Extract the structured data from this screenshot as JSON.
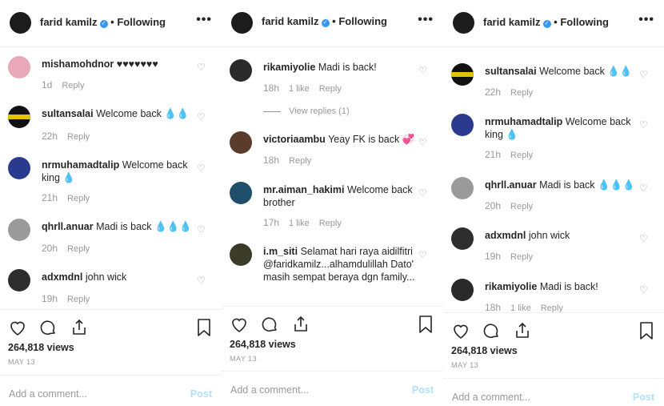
{
  "header": {
    "username": "farid kamilz",
    "separator": "•",
    "following": "Following",
    "more": "•••"
  },
  "panels": [
    {
      "comments": [
        {
          "user": "mishamohdnor",
          "text": "♥♥♥♥♥♥♥",
          "time": "1d",
          "likes": "",
          "reply": "Reply"
        },
        {
          "user": "sultansalai",
          "text": "Welcome back 💧💧",
          "time": "22h",
          "likes": "",
          "reply": "Reply"
        },
        {
          "user": "nrmuhamadtalip",
          "text": "Welcome back king 💧",
          "time": "21h",
          "likes": "",
          "reply": "Reply"
        },
        {
          "user": "qhrll.anuar",
          "text": "Madi is back 💧💧💧",
          "time": "20h",
          "likes": "",
          "reply": "Reply"
        },
        {
          "user": "adxmdnl",
          "text": "john wick",
          "time": "19h",
          "likes": "",
          "reply": "Reply"
        }
      ],
      "views": "264,818 views",
      "date": "MAY 13"
    },
    {
      "comments": [
        {
          "user": "rikamiyolie",
          "text": "Madi is back!",
          "time": "18h",
          "likes": "1 like",
          "reply": "Reply"
        },
        {
          "user": "victoriaambu",
          "text": "Yeay FK is back 💞",
          "time": "18h",
          "likes": "",
          "reply": "Reply"
        },
        {
          "user": "mr.aiman_hakimi",
          "text": "Welcome back brother",
          "time": "17h",
          "likes": "1 like",
          "reply": "Reply"
        },
        {
          "user": "i.m_siti",
          "text": "Selamat hari raya aidilfitri @faridkamilz...alhamdulillah Dato' masih sempat beraya dgn family...",
          "time": "",
          "likes": "",
          "reply": ""
        }
      ],
      "view_replies": "View replies (1)",
      "views": "264,818 views",
      "date": "MAY 13"
    },
    {
      "comments": [
        {
          "user": "sultansalai",
          "text": "Welcome back 💧💧",
          "time": "22h",
          "likes": "",
          "reply": "Reply"
        },
        {
          "user": "nrmuhamadtalip",
          "text": "Welcome back king 💧",
          "time": "21h",
          "likes": "",
          "reply": "Reply"
        },
        {
          "user": "qhrll.anuar",
          "text": "Madi is back 💧💧💧",
          "time": "20h",
          "likes": "",
          "reply": "Reply"
        },
        {
          "user": "adxmdnl",
          "text": "john wick",
          "time": "19h",
          "likes": "",
          "reply": "Reply"
        },
        {
          "user": "rikamiyolie",
          "text": "Madi is back!",
          "time": "18h",
          "likes": "1 like",
          "reply": "Reply"
        }
      ],
      "views": "264,818 views",
      "date": "MAY 13"
    }
  ],
  "add_comment": {
    "placeholder": "Add a comment...",
    "post": "Post"
  },
  "colors": {
    "verified": "#3897f0",
    "muted": "#999999",
    "post_disabled": "#b2dffc"
  },
  "icons": [
    "heart-icon",
    "comment-icon",
    "share-icon",
    "bookmark-icon",
    "more-icon"
  ]
}
